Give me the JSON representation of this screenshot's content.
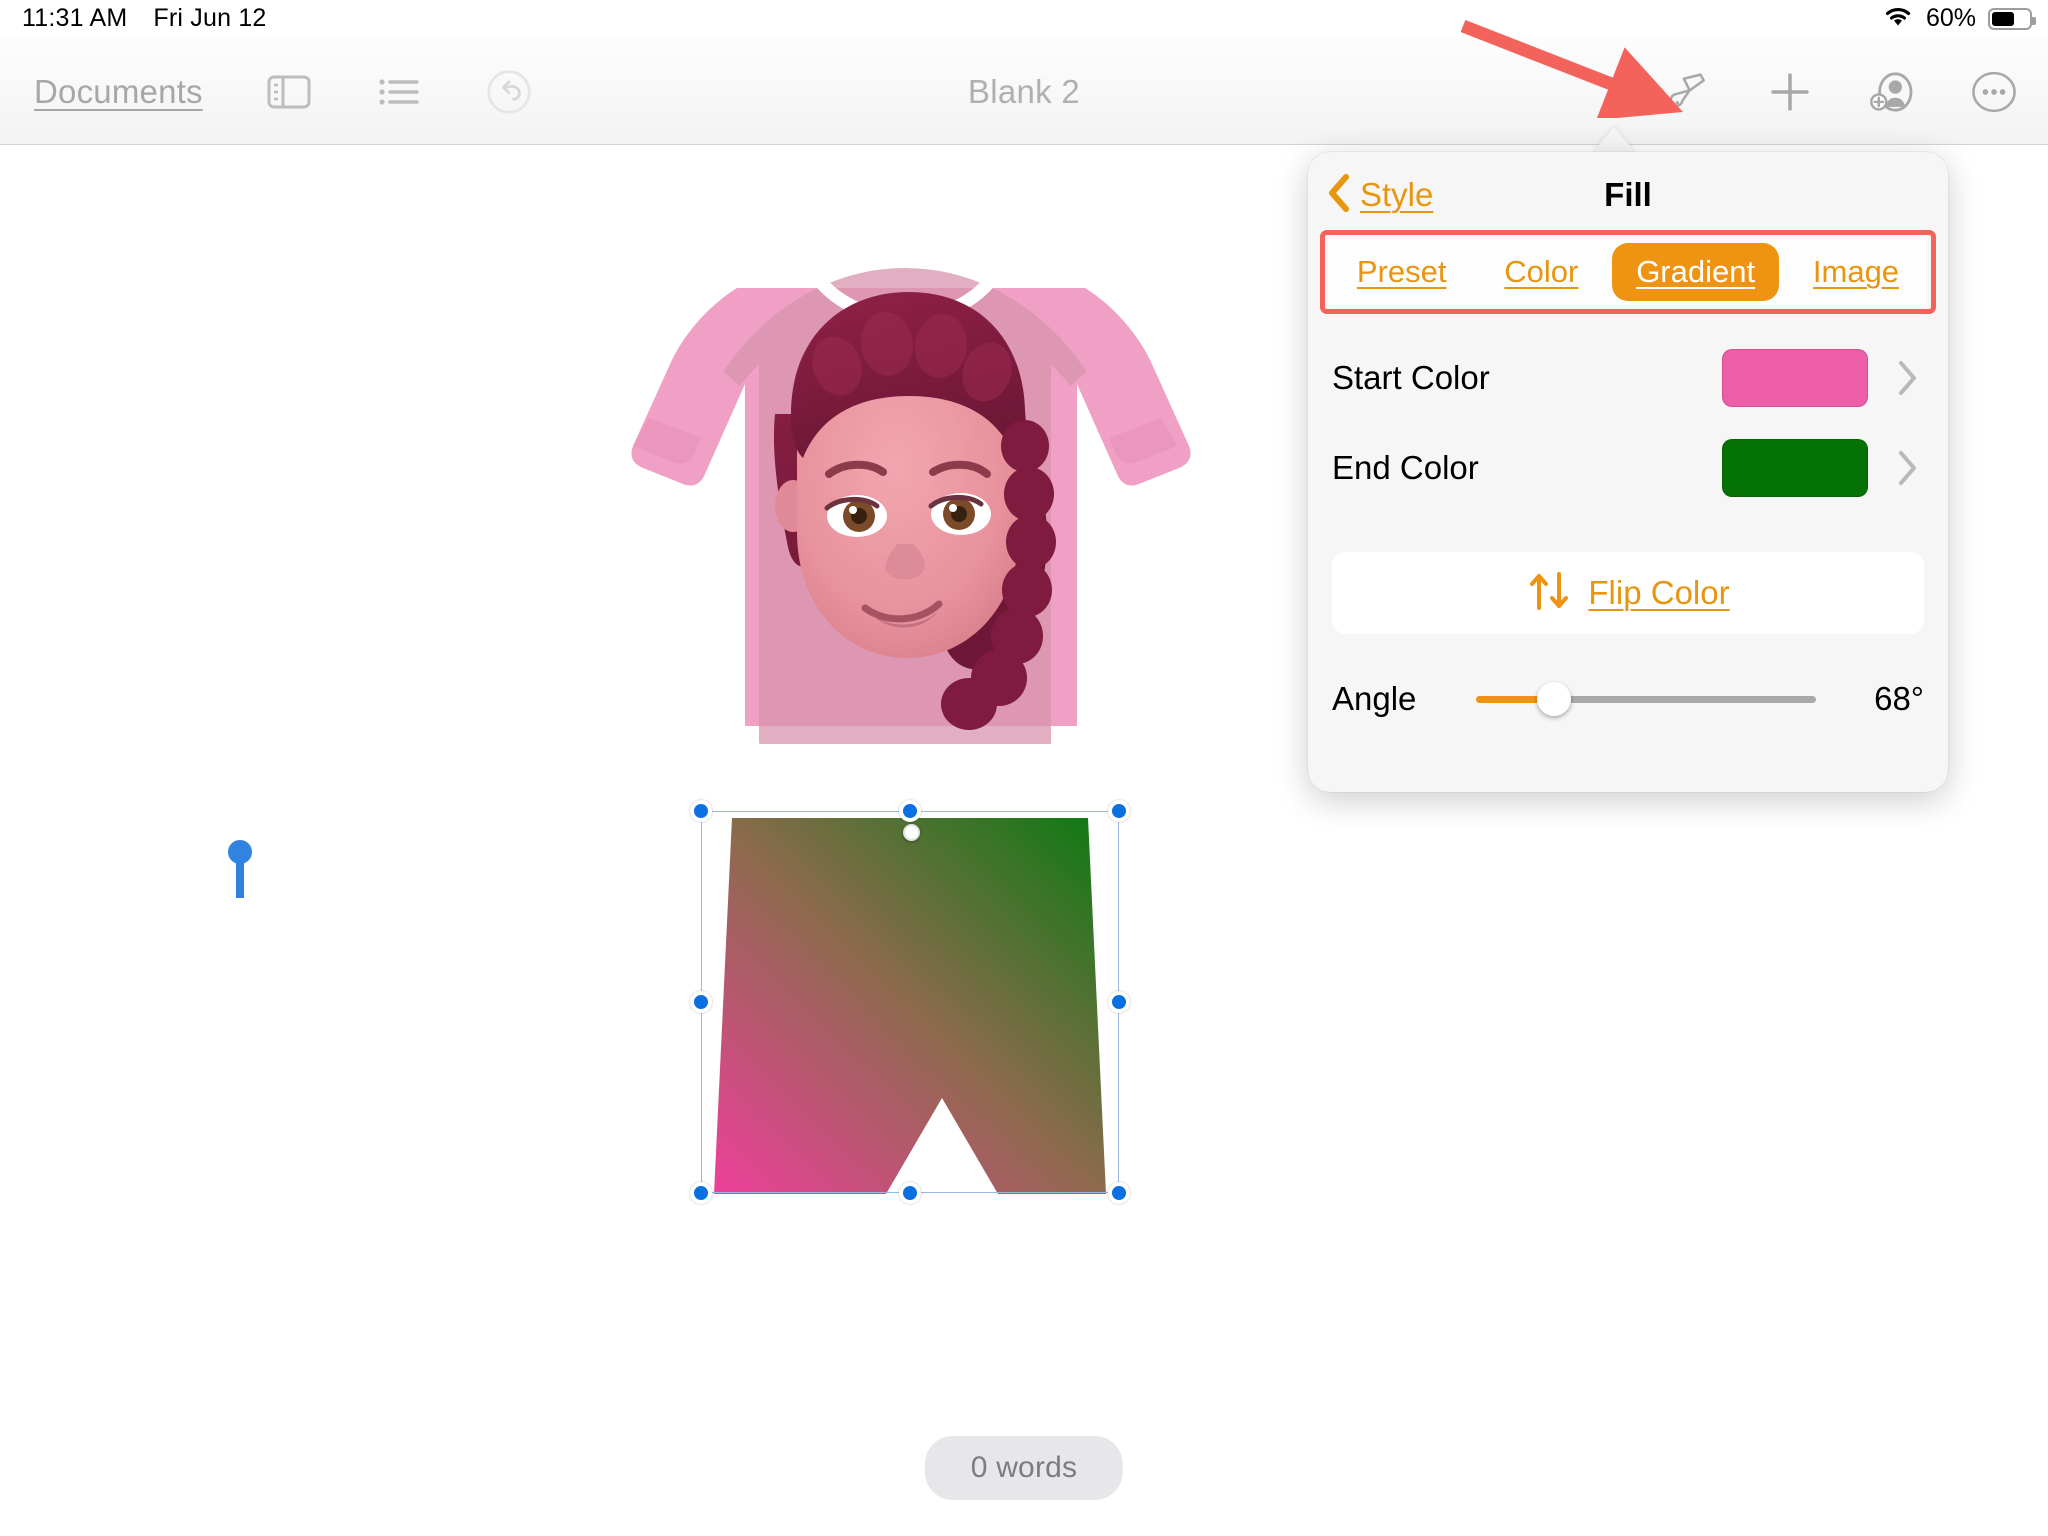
{
  "status_bar": {
    "time": "11:31 AM",
    "date": "Fri Jun 12",
    "wifi_icon": "wifi-icon",
    "battery_percent": "60%",
    "battery_level": 60
  },
  "toolbar": {
    "documents_label": "Documents",
    "sidebar_icon": "sidebar-toggle-icon",
    "list_icon": "list-view-icon",
    "undo_icon": "undo-icon",
    "title": "Blank 2",
    "format_icon": "paintbrush-icon",
    "insert_icon": "plus-icon",
    "collaborate_icon": "add-person-icon",
    "more_icon": "more-ellipsis-icon"
  },
  "canvas": {
    "word_count": "0 words",
    "text_cursor": "text-insertion-cursor",
    "sweater_image": "pink-sweater-with-memoji-image",
    "shorts_shape": {
      "name": "shorts-gradient-shape",
      "gradient_start": "#E8479B",
      "gradient_end": "#0B7A12",
      "gradient_angle_deg": 68
    }
  },
  "popover": {
    "back_label": "Style",
    "back_icon": "chevron-left-icon",
    "title": "Fill",
    "tabs": [
      {
        "label": "Preset",
        "active": false
      },
      {
        "label": "Color",
        "active": false
      },
      {
        "label": "Gradient",
        "active": true
      },
      {
        "label": "Image",
        "active": false
      }
    ],
    "rows": [
      {
        "label": "Start Color",
        "color": "#EE5DA8",
        "chevron": "chevron-right-icon"
      },
      {
        "label": "End Color",
        "color": "#047205",
        "chevron": "chevron-right-icon"
      }
    ],
    "flip": {
      "label": "Flip Color",
      "icon": "flip-arrows-icon",
      "glyph": "↑↓"
    },
    "angle": {
      "label": "Angle",
      "value": "68°",
      "percent": 23
    }
  },
  "annotations": {
    "arrow_color": "#F4625C",
    "highlight_box_color": "#F4625C",
    "arrow_name": "red-pointer-arrow",
    "box_name": "red-highlight-rectangle"
  },
  "colors": {
    "accent_orange": "#EF9313",
    "link_orange": "#E8960F",
    "selection_blue": "#0A6FE0",
    "annotation_red": "#F4625C"
  }
}
